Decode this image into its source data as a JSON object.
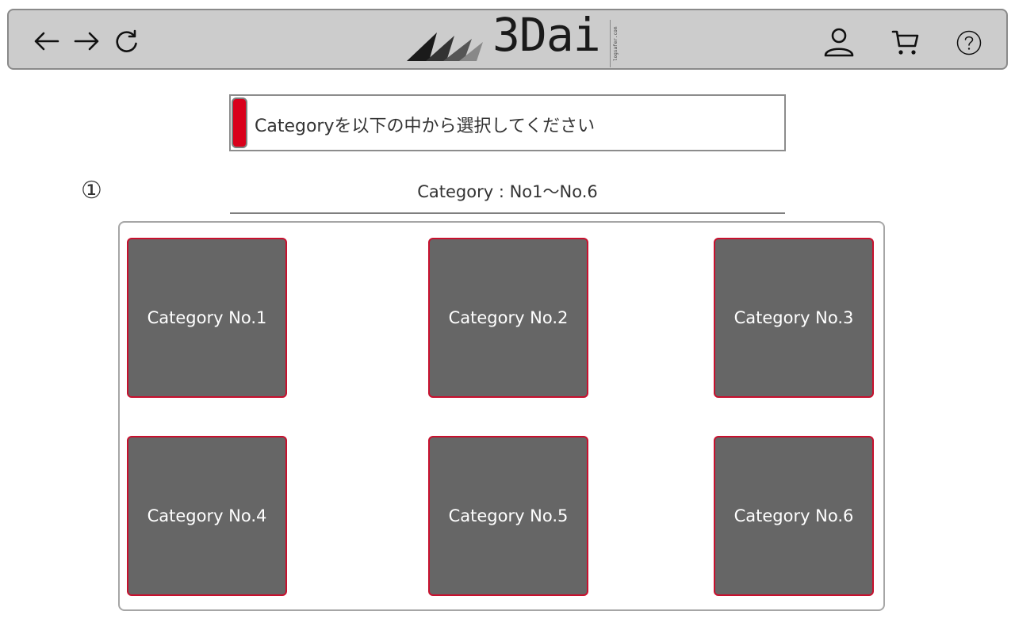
{
  "header": {
    "back_icon": "arrow-left-icon",
    "forward_icon": "arrow-right-icon",
    "reload_icon": "reload-icon",
    "logo_text": "3Dai",
    "logo_site": "logsafer.com",
    "account_icon": "user-icon",
    "cart_icon": "cart-icon",
    "help_icon": "help-icon"
  },
  "instruction": {
    "text": "Categoryを以下の中から選択してください"
  },
  "section": {
    "step": "①",
    "title": "Category : No1～No.6"
  },
  "categories": [
    {
      "label": "Category No.1"
    },
    {
      "label": "Category No.2"
    },
    {
      "label": "Category No.3"
    },
    {
      "label": "Category No.4"
    },
    {
      "label": "Category No.5"
    },
    {
      "label": "Category No.6"
    }
  ],
  "colors": {
    "topbar_bg": "#cccccc",
    "accent_red": "#d9001b",
    "card_bg": "#666666",
    "card_border": "#c8102e"
  }
}
